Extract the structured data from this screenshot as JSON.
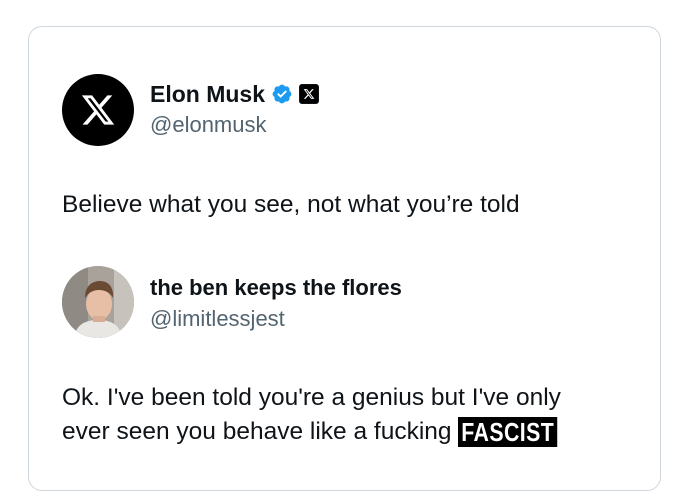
{
  "original_tweet": {
    "display_name": "Elon Musk",
    "handle": "@elonmusk",
    "text": "Believe what you see, not what you’re told",
    "avatar_icon": "x-logo-icon",
    "badges": [
      "verified-badge-icon",
      "x-affiliation-badge-icon"
    ],
    "badge_color": "#1d9bf0"
  },
  "reply_tweet": {
    "display_name": "the ben keeps the flores",
    "handle": "@limitlessjest",
    "text_line1": "Ok. I've been told you're a genius but I've only",
    "text_line2": "ever seen you behave like a fucking",
    "overlay_stamp": "FASCIST"
  },
  "colors": {
    "text": "#0f1419",
    "secondary_text": "#536471",
    "card_border": "#cfd6dc"
  }
}
